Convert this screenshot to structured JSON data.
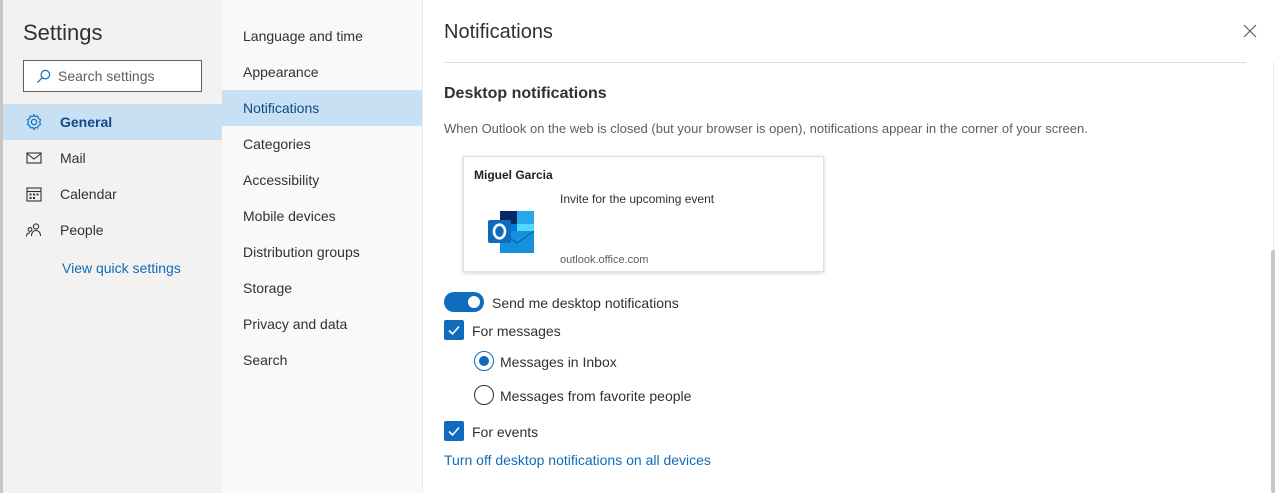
{
  "settings": {
    "title": "Settings",
    "search_placeholder": "Search settings",
    "categories": [
      {
        "label": "General",
        "icon": "gear-icon"
      },
      {
        "label": "Mail",
        "icon": "mail-icon"
      },
      {
        "label": "Calendar",
        "icon": "calendar-icon"
      },
      {
        "label": "People",
        "icon": "people-icon"
      }
    ],
    "quick_settings_link": "View quick settings"
  },
  "subnav": {
    "items": [
      "Language and time",
      "Appearance",
      "Notifications",
      "Categories",
      "Accessibility",
      "Mobile devices",
      "Distribution groups",
      "Storage",
      "Privacy and data",
      "Search"
    ],
    "active": "Notifications"
  },
  "pane": {
    "title": "Notifications",
    "section_title": "Desktop notifications",
    "section_desc": "When Outlook on the web is closed (but your browser is open), notifications appear in the corner of your screen.",
    "preview": {
      "sender": "Miguel Garcia",
      "subject": "Invite for the upcoming event",
      "domain": "outlook.office.com",
      "logo_icon": "outlook-logo-icon"
    },
    "toggle_label": "Send me desktop notifications",
    "toggle_on": true,
    "for_messages_label": "For messages",
    "for_messages_checked": true,
    "radio_inbox_label": "Messages in Inbox",
    "radio_favorites_label": "Messages from favorite people",
    "selected_radio": "Messages in Inbox",
    "for_events_label": "For events",
    "for_events_checked": true,
    "turn_off_link": "Turn off desktop notifications on all devices"
  },
  "colors": {
    "accent": "#0f6cbd",
    "selected_bg": "#c7e0f4",
    "sidebar_bg": "#f3f2f1",
    "subnav_bg": "#faf9f8"
  }
}
